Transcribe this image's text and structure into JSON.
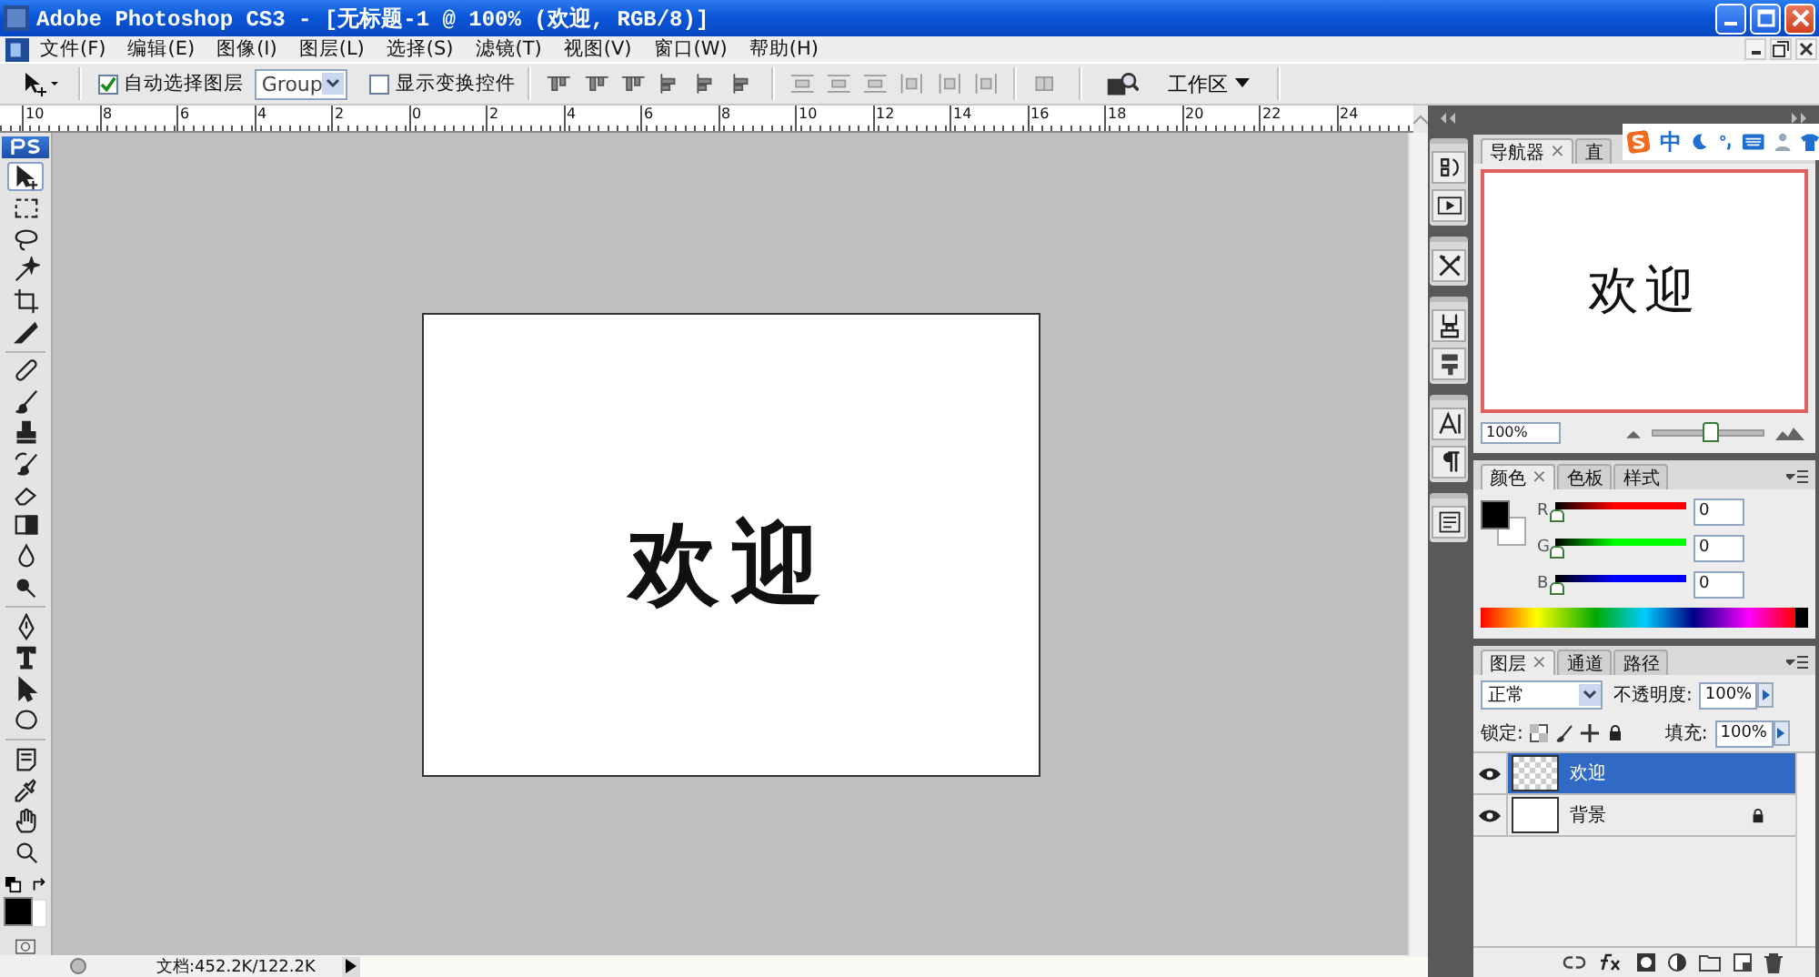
{
  "window": {
    "title": "Adobe Photoshop CS3 - [无标题-1 @ 100% (欢迎, RGB/8)]"
  },
  "menu": [
    "文件(F)",
    "编辑(E)",
    "图像(I)",
    "图层(L)",
    "选择(S)",
    "滤镜(T)",
    "视图(V)",
    "窗口(W)",
    "帮助(H)"
  ],
  "options_bar": {
    "auto_select": {
      "label": "自动选择图层",
      "checked": true
    },
    "auto_select_target": "Group",
    "transform_controls": {
      "label": "显示变换控件",
      "checked": false
    },
    "workspace": "工作区"
  },
  "ruler": {
    "labels": [
      "10",
      "8",
      "6",
      "4",
      "2",
      "0",
      "2",
      "4",
      "6",
      "8",
      "10",
      "12",
      "14",
      "16",
      "18",
      "20",
      "22",
      "24"
    ]
  },
  "toolbox": {
    "tool_groups": [
      [
        {
          "kind": "move",
          "selected": true
        },
        {
          "kind": "marquee",
          "selected": false
        },
        {
          "kind": "lasso",
          "selected": false
        },
        {
          "kind": "wand",
          "selected": false
        },
        {
          "kind": "crop",
          "selected": false
        },
        {
          "kind": "slice",
          "selected": false
        }
      ],
      [
        {
          "kind": "healing",
          "selected": false
        },
        {
          "kind": "brush",
          "selected": false
        },
        {
          "kind": "stamp",
          "selected": false
        },
        {
          "kind": "history",
          "selected": false
        },
        {
          "kind": "eraser",
          "selected": false
        },
        {
          "kind": "gradient",
          "selected": false
        },
        {
          "kind": "blur",
          "selected": false
        },
        {
          "kind": "dodge",
          "selected": false
        }
      ],
      [
        {
          "kind": "pen",
          "selected": false
        },
        {
          "kind": "type",
          "selected": false
        },
        {
          "kind": "path",
          "selected": false
        },
        {
          "kind": "shape",
          "selected": false
        }
      ],
      [
        {
          "kind": "notes",
          "selected": false
        },
        {
          "kind": "eyedropper",
          "selected": false
        },
        {
          "kind": "hand",
          "selected": false
        },
        {
          "kind": "zoom",
          "selected": false
        }
      ]
    ]
  },
  "document": {
    "text": "欢迎"
  },
  "status_bar": {
    "doc_size": "文档:452.2K/122.2K"
  },
  "ime_bar": {
    "mode": "中"
  },
  "navigator": {
    "tabs": [
      {
        "label": "导航器",
        "close": "×",
        "selected": true
      },
      {
        "label": "直",
        "selected": false
      }
    ],
    "preview_text": "欢迎",
    "zoom": "100%",
    "zoom_slider": {
      "level": 0.5
    }
  },
  "color": {
    "tabs": [
      {
        "label": "颜色",
        "close": "×",
        "selected": true
      },
      {
        "label": "色板",
        "selected": false
      },
      {
        "label": "样式",
        "selected": false
      }
    ],
    "channels": [
      {
        "name": "R",
        "value": "0",
        "level": 0,
        "color": "#ff0000"
      },
      {
        "name": "G",
        "value": "0",
        "level": 0,
        "color": "#00ff00"
      },
      {
        "name": "B",
        "value": "0",
        "level": 0,
        "color": "#0000ff"
      }
    ]
  },
  "layers": {
    "tabs": [
      {
        "label": "图层",
        "close": "×",
        "selected": true
      },
      {
        "label": "通道",
        "selected": false
      },
      {
        "label": "路径",
        "selected": false
      }
    ],
    "blend_mode": "正常",
    "opacity_label": "不透明度:",
    "opacity": "100%",
    "lock_label": "锁定:",
    "fill_label": "填充:",
    "fill": "100%",
    "items": [
      {
        "name": "欢迎",
        "kind": "text",
        "selected": true,
        "visible": true,
        "locked": false
      },
      {
        "name": "背景",
        "kind": "background",
        "selected": false,
        "visible": true,
        "locked": true
      }
    ]
  }
}
